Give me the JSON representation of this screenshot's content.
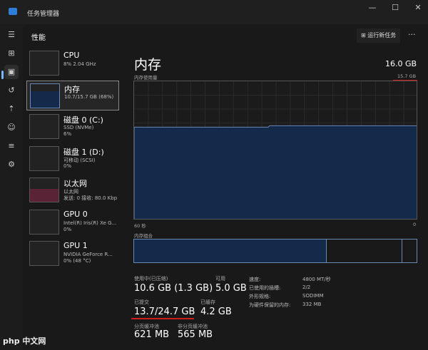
{
  "window": {
    "title": "任务管理器",
    "min": "—",
    "max": "☐",
    "close": "✕"
  },
  "header": {
    "title": "性能",
    "run_task": "运行新任务",
    "more": "···"
  },
  "nav": [
    {
      "icon": "hamburger-icon",
      "g": "☰"
    },
    {
      "icon": "processes-icon",
      "g": "⊞"
    },
    {
      "icon": "performance-icon",
      "g": "▣"
    },
    {
      "icon": "history-icon",
      "g": "↺"
    },
    {
      "icon": "startup-icon",
      "g": "⇡"
    },
    {
      "icon": "users-icon",
      "g": "☺"
    },
    {
      "icon": "details-icon",
      "g": "≡"
    },
    {
      "icon": "services-icon",
      "g": "⚙"
    }
  ],
  "devices": [
    {
      "name": "CPU",
      "sub": [
        "8% 2.04 GHz"
      ]
    },
    {
      "name": "内存",
      "sub": [
        "10.7/15.7 GB (68%)"
      ]
    },
    {
      "name": "磁盘 0 (C:)",
      "sub": [
        "SSD (NVMe)",
        "6%"
      ]
    },
    {
      "name": "磁盘 1 (D:)",
      "sub": [
        "可移动 (SCSI)",
        "0%"
      ]
    },
    {
      "name": "以太网",
      "sub": [
        "以太网",
        "发送: 0 接收: 80.0 Kbp"
      ]
    },
    {
      "name": "GPU 0",
      "sub": [
        "Intel(R) Iris(R) Xe G...",
        "0%"
      ]
    },
    {
      "name": "GPU 1",
      "sub": [
        "NVIDIA GeForce R...",
        "0% (48 °C)"
      ]
    }
  ],
  "memory": {
    "title": "内存",
    "total": "16.0 GB",
    "usage_label": "内存使用量",
    "usage_max": "15.7 GB",
    "time_left": "60 秒",
    "time_right": "0",
    "composition_label": "内存组合",
    "usage_fraction": 0.68,
    "stats": {
      "in_use_label": "使用中(已压缩)",
      "in_use": "10.6 GB (1.3 GB)",
      "available_label": "可用",
      "available": "5.0 GB",
      "committed_label": "已提交",
      "committed": "13.7/24.7 GB",
      "cached_label": "已缓存",
      "cached": "4.2 GB",
      "paged_label": "分页缓冲池",
      "paged": "621 MB",
      "nonpaged_label": "非分页缓冲池",
      "nonpaged": "565 MB"
    },
    "details": [
      {
        "k": "速度:",
        "v": "4800 MT/秒"
      },
      {
        "k": "已使用的插槽:",
        "v": "2/2"
      },
      {
        "k": "外形规格:",
        "v": "SODIMM"
      },
      {
        "k": "为硬件保留的内存:",
        "v": "332 MB"
      }
    ]
  },
  "colors": {
    "memory_fill": "#142a4a",
    "memory_line": "#6a87b5",
    "annotation": "#d01c1c"
  },
  "watermark": "php 中文网"
}
